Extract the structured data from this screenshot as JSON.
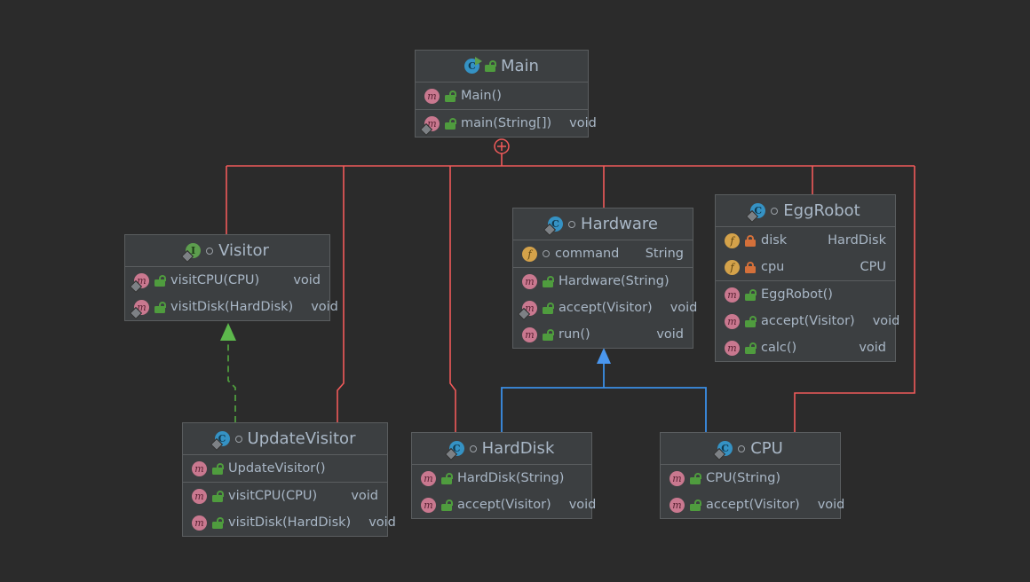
{
  "theme": {
    "background": "#2b2b2b",
    "box_fill": "#3c3f41",
    "box_border": "#5a5d5f",
    "text": "#a9b7c6",
    "dependency_edge": "#f05a5a",
    "inheritance_edge": "#3a8ee6",
    "realization_edge": "#4f9c3e",
    "icon_method": "#c9788f",
    "icon_field": "#d4a24a",
    "icon_class": "#3592c4",
    "icon_interface": "#5d9e4e",
    "lock_public": "#4f9c3e",
    "lock_private": "#d4703a"
  },
  "diagram": {
    "kind": "uml-class-diagram",
    "classes": [
      {
        "id": "main",
        "name": "Main",
        "stereotype": "class",
        "icon": "class-runnable-icon",
        "abstract": false,
        "sections": [
          [
            {
              "icon": "method-icon",
              "visibility": "public",
              "name": "Main()",
              "type": ""
            }
          ],
          [
            {
              "icon": "method-icon",
              "visibility": "public",
              "name": "main(String[])",
              "type": "void",
              "static": true
            }
          ]
        ]
      },
      {
        "id": "visitor",
        "name": "Visitor",
        "stereotype": "interface",
        "icon": "interface-icon",
        "abstract": true,
        "sections": [
          [
            {
              "icon": "method-icon",
              "visibility": "public",
              "name": "visitCPU(CPU)",
              "type": "void",
              "abstract": true
            },
            {
              "icon": "method-icon",
              "visibility": "public",
              "name": "visitDisk(HardDisk)",
              "type": "void",
              "abstract": true
            }
          ]
        ]
      },
      {
        "id": "hardware",
        "name": "Hardware",
        "stereotype": "class",
        "icon": "class-icon",
        "abstract": true,
        "sections": [
          [
            {
              "icon": "field-icon",
              "visibility": "abstract-dot",
              "name": "command",
              "type": "String"
            }
          ],
          [
            {
              "icon": "method-icon",
              "visibility": "public",
              "name": "Hardware(String)",
              "type": ""
            },
            {
              "icon": "method-icon",
              "visibility": "public",
              "name": "accept(Visitor)",
              "type": "void",
              "abstract": true
            },
            {
              "icon": "method-icon",
              "visibility": "public",
              "name": "run()",
              "type": "void"
            }
          ]
        ]
      },
      {
        "id": "eggrobot",
        "name": "EggRobot",
        "stereotype": "class",
        "icon": "class-icon",
        "abstract": true,
        "sections": [
          [
            {
              "icon": "field-icon",
              "visibility": "private",
              "name": "disk",
              "type": "HardDisk"
            },
            {
              "icon": "field-icon",
              "visibility": "private",
              "name": "cpu",
              "type": "CPU"
            }
          ],
          [
            {
              "icon": "method-icon",
              "visibility": "public",
              "name": "EggRobot()",
              "type": ""
            },
            {
              "icon": "method-icon",
              "visibility": "public",
              "name": "accept(Visitor)",
              "type": "void"
            },
            {
              "icon": "method-icon",
              "visibility": "public",
              "name": "calc()",
              "type": "void"
            }
          ]
        ]
      },
      {
        "id": "updatevisitor",
        "name": "UpdateVisitor",
        "stereotype": "class",
        "icon": "class-icon",
        "abstract": true,
        "sections": [
          [
            {
              "icon": "method-icon",
              "visibility": "public",
              "name": "UpdateVisitor()",
              "type": ""
            }
          ],
          [
            {
              "icon": "method-icon",
              "visibility": "public",
              "name": "visitCPU(CPU)",
              "type": "void"
            },
            {
              "icon": "method-icon",
              "visibility": "public",
              "name": "visitDisk(HardDisk)",
              "type": "void"
            }
          ]
        ]
      },
      {
        "id": "harddisk",
        "name": "HardDisk",
        "stereotype": "class",
        "icon": "class-icon",
        "abstract": true,
        "sections": [
          [
            {
              "icon": "method-icon",
              "visibility": "public",
              "name": "HardDisk(String)",
              "type": ""
            },
            {
              "icon": "method-icon",
              "visibility": "public",
              "name": "accept(Visitor)",
              "type": "void"
            }
          ]
        ]
      },
      {
        "id": "cpu",
        "name": "CPU",
        "stereotype": "class",
        "icon": "class-icon",
        "abstract": true,
        "sections": [
          [
            {
              "icon": "method-icon",
              "visibility": "public",
              "name": "CPU(String)",
              "type": ""
            },
            {
              "icon": "method-icon",
              "visibility": "public",
              "name": "accept(Visitor)",
              "type": "void"
            }
          ]
        ]
      }
    ],
    "edges": [
      {
        "from": "main",
        "to": "visitor",
        "kind": "dependency",
        "color": "#f05a5a"
      },
      {
        "from": "main",
        "to": "updatevisitor",
        "kind": "dependency",
        "color": "#f05a5a"
      },
      {
        "from": "main",
        "to": "harddisk",
        "kind": "dependency",
        "color": "#f05a5a"
      },
      {
        "from": "main",
        "to": "hardware",
        "kind": "dependency",
        "color": "#f05a5a"
      },
      {
        "from": "main",
        "to": "eggrobot",
        "kind": "dependency",
        "color": "#f05a5a"
      },
      {
        "from": "main",
        "to": "cpu",
        "kind": "dependency",
        "color": "#f05a5a"
      },
      {
        "from": "harddisk",
        "to": "hardware",
        "kind": "inheritance",
        "color": "#3a8ee6"
      },
      {
        "from": "cpu",
        "to": "hardware",
        "kind": "inheritance",
        "color": "#3a8ee6"
      },
      {
        "from": "updatevisitor",
        "to": "visitor",
        "kind": "realization",
        "color": "#4f9c3e"
      }
    ]
  }
}
